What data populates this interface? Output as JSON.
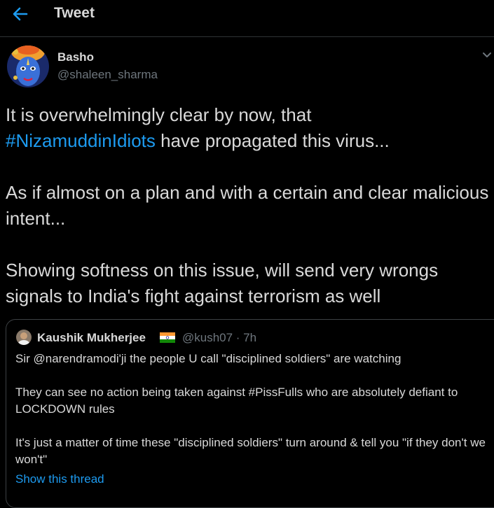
{
  "header": {
    "title": "Tweet",
    "back_icon": "arrow-left-icon"
  },
  "tweet": {
    "author_name": "Basho",
    "author_handle": "@shaleen_sharma",
    "line1": "It is overwhelmingly clear by now, that",
    "hashtag": "#NizamuddinIdiots",
    "line2_rest": " have propagated this virus...",
    "para2": "As if almost on a plan and with a certain and clear malicious intent...",
    "para3": "Showing softness on this issue, will send very wrongs signals to India's fight against terrorism as well"
  },
  "quoted": {
    "author_name": "Kaushik Mukherjee",
    "meta": "@kush07 · 7h",
    "para1": "Sir @narendramodi'ji the people U call \"disciplined soldiers\" are watching",
    "para2": "They can see no action being taken against #PissFulls who are absolutely defiant to LOCKDOWN rules",
    "para3": "It's just a matter of time these \"disciplined soldiers\" turn around & tell you \"if they don't we won't\"",
    "show_thread": "Show this thread"
  },
  "colors": {
    "background": "#000000",
    "text": "#d9d9d9",
    "secondary": "#6e767d",
    "link": "#1d9bf0",
    "border": "#2f3336"
  }
}
